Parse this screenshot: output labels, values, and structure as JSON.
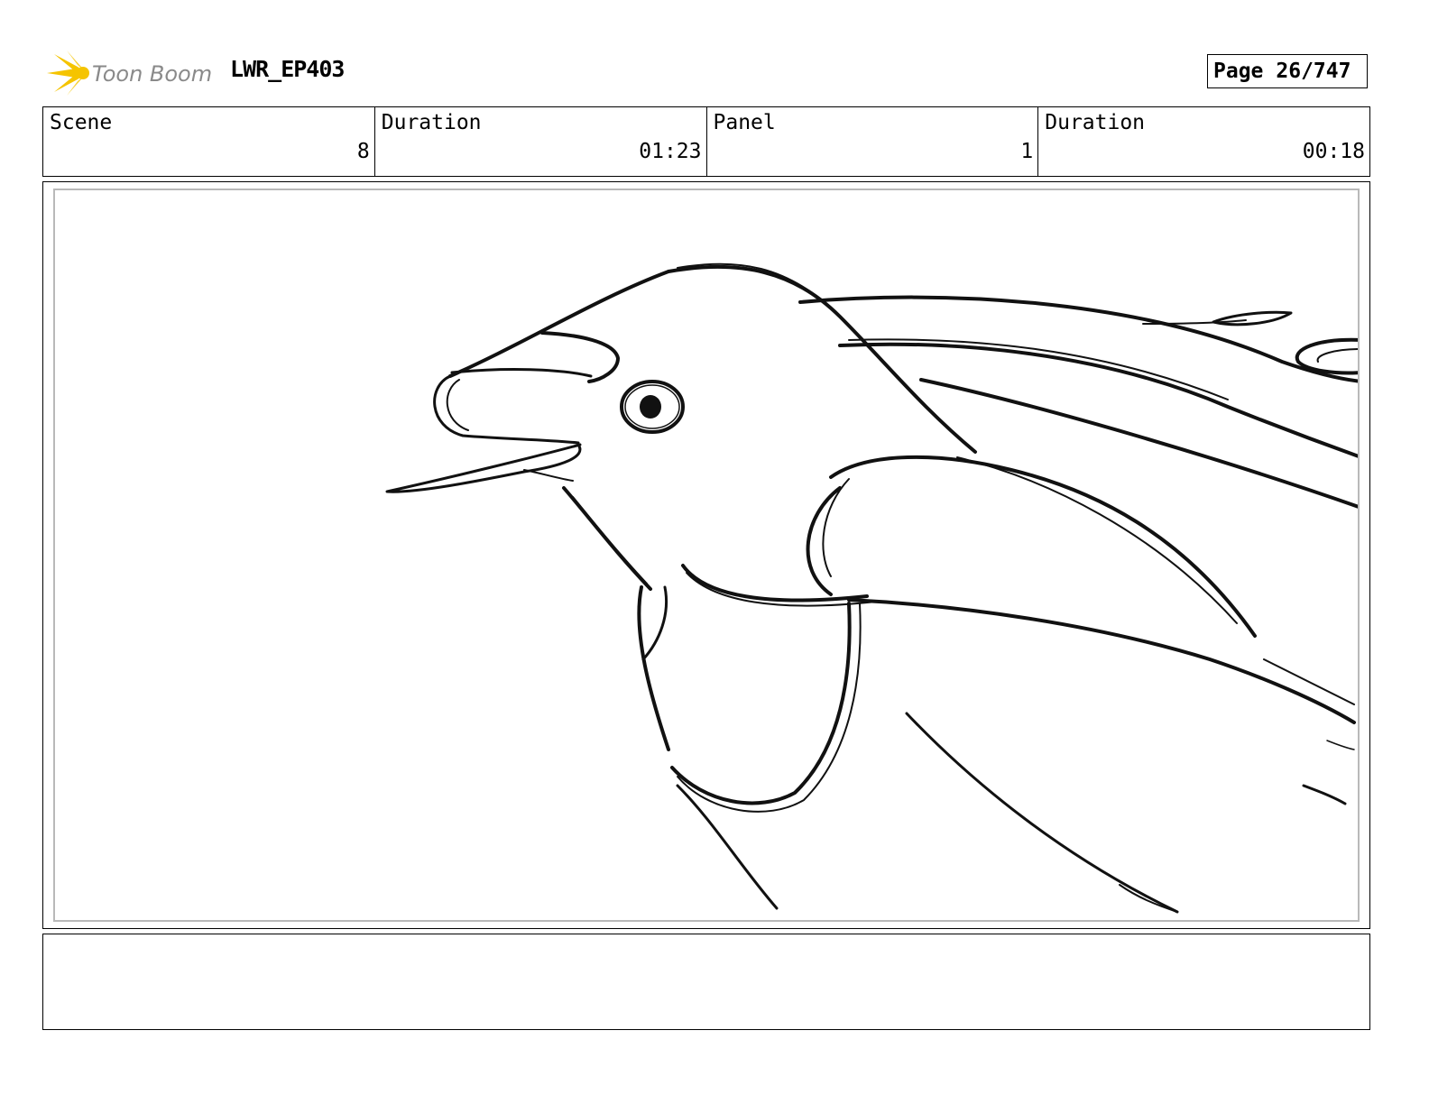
{
  "header": {
    "logo_text": "Toon Boom",
    "project": "LWR_EP403",
    "page_label": "Page",
    "page_value": "26/747"
  },
  "info": {
    "scene_label": "Scene",
    "scene_value": "8",
    "scene_duration_label": "Duration",
    "scene_duration_value": "01:23",
    "panel_label": "Panel",
    "panel_value": "1",
    "panel_duration_label": "Duration",
    "panel_duration_value": "00:18"
  },
  "colors": {
    "logo_burst": "#f5c400",
    "logo_text": "#8a8a8a",
    "panel_border": "#b9b9b9"
  }
}
